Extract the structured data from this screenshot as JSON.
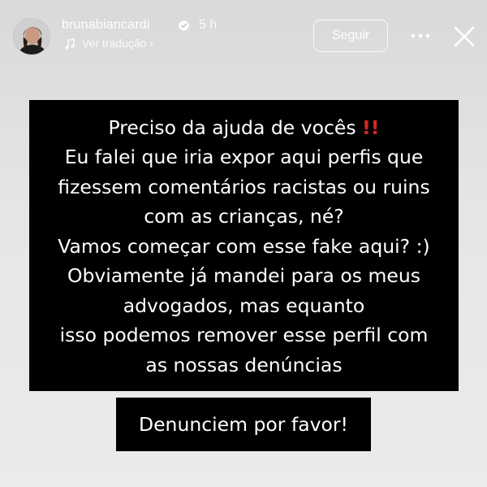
{
  "header": {
    "username": "brunabiancardi",
    "time": "5 h",
    "translate_label": "Ver tradução ›",
    "follow_label": "Seguir",
    "icons": {
      "verified": "verified-badge-icon",
      "translate": "music-note-icon",
      "more": "more-options-icon",
      "close": "close-icon"
    }
  },
  "story": {
    "lines": [
      "Preciso da ajuda de vocês ‼️",
      "Eu falei que iria expor aqui perfis que",
      "fizessem comentários racistas ou ruins",
      "com as crianças, né?",
      "Vamos começar com esse fake aqui? :)",
      "Obviamente já mandei para os meus",
      "advogados, mas equanto",
      "isso podemos remover esse perfil com",
      "as nossas denúncias"
    ],
    "cta": "Denunciem por favor!"
  },
  "colors": {
    "background": "#e3e3e3",
    "text_box": "#000000",
    "text": "#ffffff",
    "verified": "#ffffff",
    "exclamation": "#e0241b"
  }
}
